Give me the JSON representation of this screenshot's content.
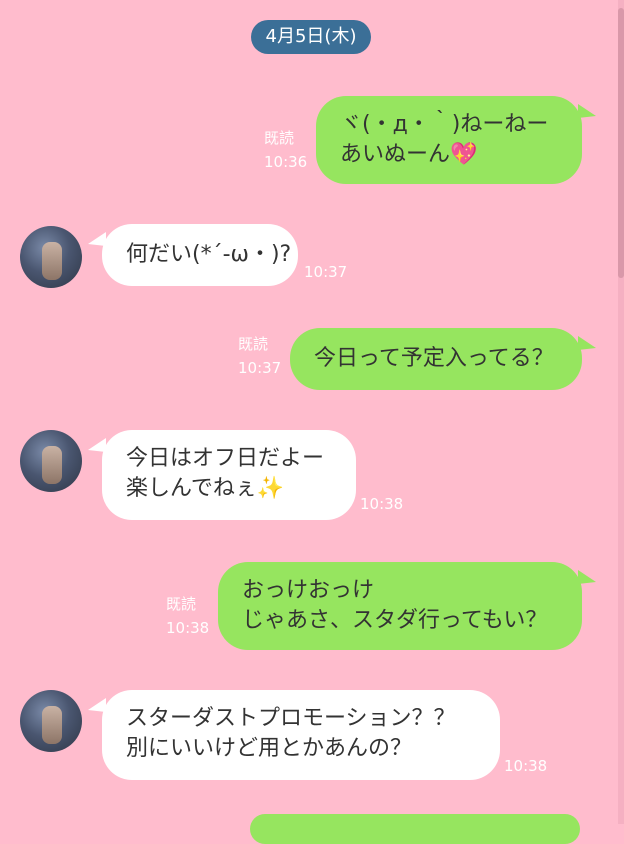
{
  "date_label": "4月5日(木)",
  "read_label": "既読",
  "messages": [
    {
      "direction": "out",
      "lines": [
        "ヾ(・д・｀)ねーねー",
        "あいぬーん"
      ],
      "time": "10:36",
      "read": true,
      "emoji": "heart"
    },
    {
      "direction": "in",
      "lines": [
        "何だい(*´-ω・)?"
      ],
      "time": "10:37"
    },
    {
      "direction": "out",
      "lines": [
        "今日って予定入ってる？"
      ],
      "time": "10:37",
      "read": true
    },
    {
      "direction": "in",
      "lines": [
        "今日はオフ日だよー",
        "楽しんでねぇ"
      ],
      "time": "10:38",
      "emoji": "sparkles"
    },
    {
      "direction": "out",
      "lines": [
        "おっけおっけ",
        "じゃあさ、スタダ行ってもい？"
      ],
      "time": "10:38",
      "read": true
    },
    {
      "direction": "in",
      "lines": [
        "スターダストプロモーション？？",
        "別にいいけど用とかあんの？"
      ],
      "time": "10:38"
    }
  ],
  "colors": {
    "background": "#ffbccd",
    "outgoing": "#96e55f",
    "incoming": "#ffffff",
    "date_pill": "#3b6f97"
  },
  "icons": {
    "heart": "sparkling-heart-emoji",
    "sparkles": "sparkles-emoji",
    "avatar": "contact-avatar"
  }
}
